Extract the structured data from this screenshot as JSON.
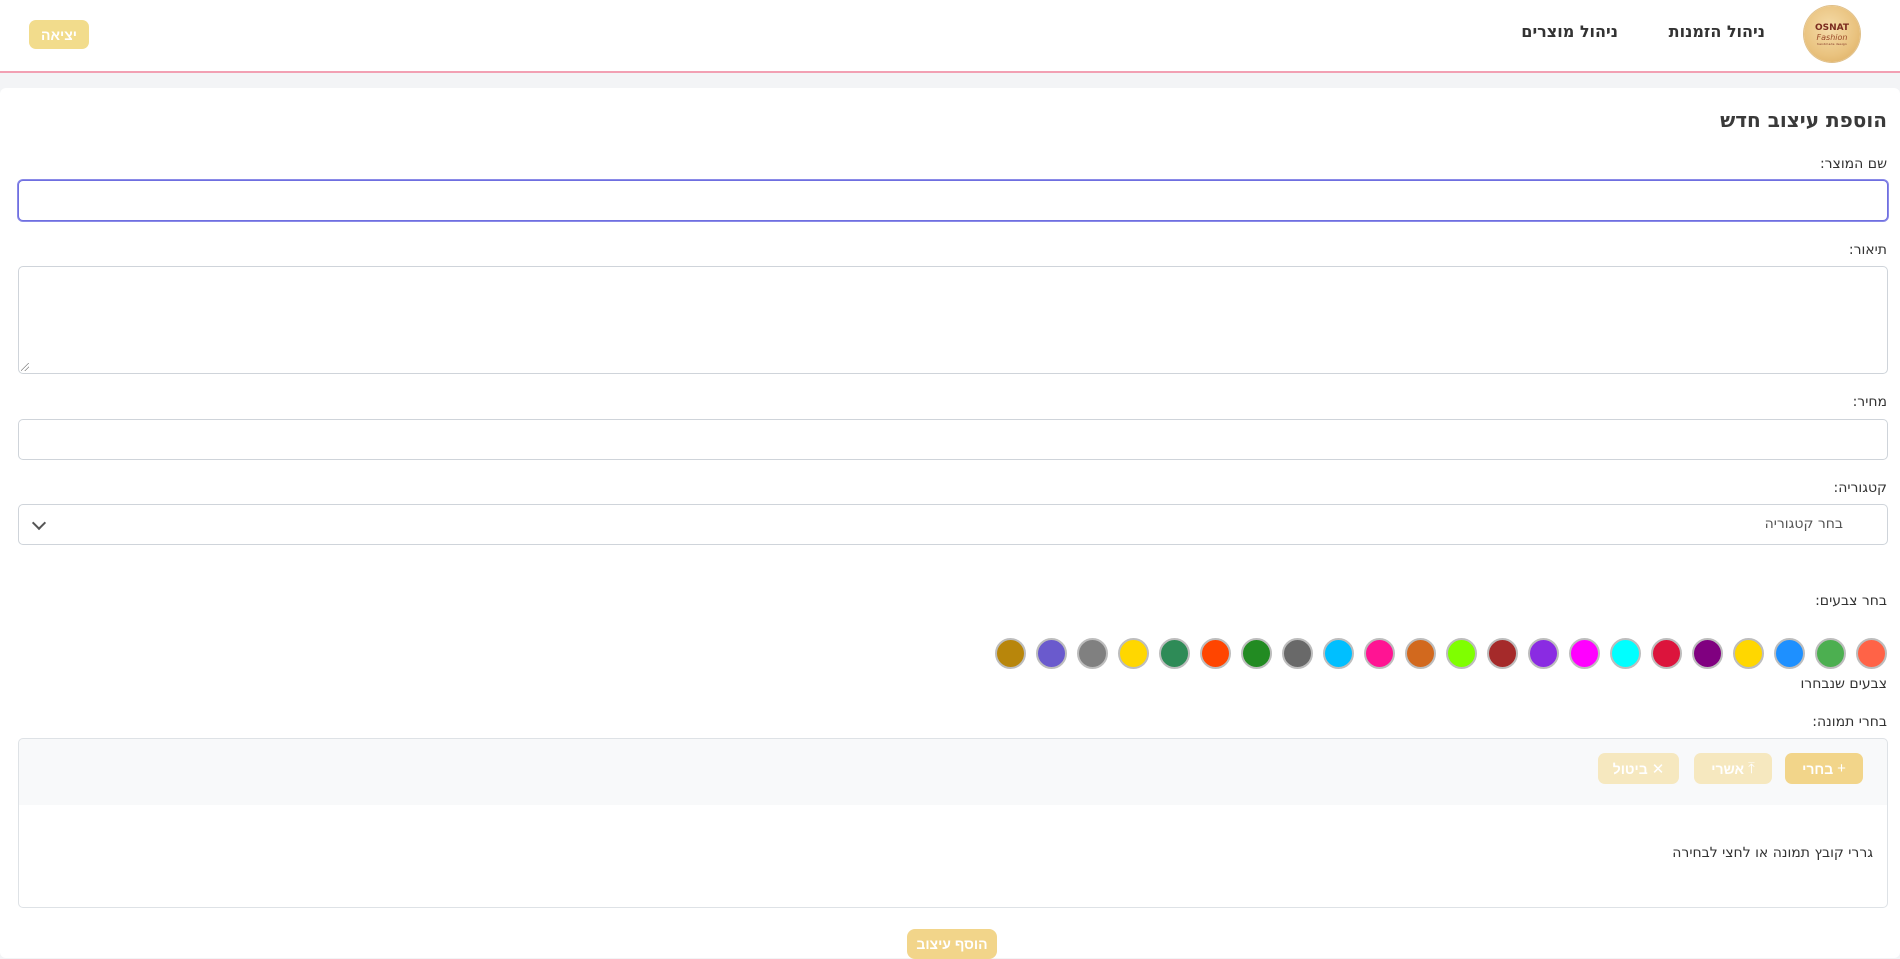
{
  "header": {
    "logo": {
      "line1": "OSNAT",
      "line2": "Fashion",
      "line3": "handmade design"
    },
    "nav": {
      "orders": "ניהול הזמנות",
      "products": "ניהול מוצרים"
    },
    "logout": "יציאה"
  },
  "form": {
    "title": "הוספת עיצוב חדש",
    "name_label": "שם המוצר:",
    "description_label": "תיאור:",
    "price_label": "מחיר:",
    "category_label": "קטגוריה:",
    "category_placeholder": "בחר קטגוריה",
    "colors_label": "בחר צבעים:",
    "selected_colors_label": "צבעים שנבחרו",
    "colors": [
      "#ff6347",
      "#4caf50",
      "#1e90ff",
      "#ffd700",
      "#800080",
      "#dc143c",
      "#00ffff",
      "#ff00ff",
      "#8a2be2",
      "#a52a2a",
      "#7fff00",
      "#d2691e",
      "#ff1493",
      "#00bfff",
      "#696969",
      "#228b22",
      "#ff4500",
      "#2e8b57",
      "#ffd700",
      "#808080",
      "#6a5acd",
      "#b8860b"
    ],
    "image_label": "בחרי תמונה:",
    "upload": {
      "choose": "בחרי",
      "upload": "אשרי",
      "cancel": "ביטול",
      "drop_text": "גררי קובץ תמונה או לחצי לבחירה"
    },
    "submit": "הוסף עיצוב"
  }
}
